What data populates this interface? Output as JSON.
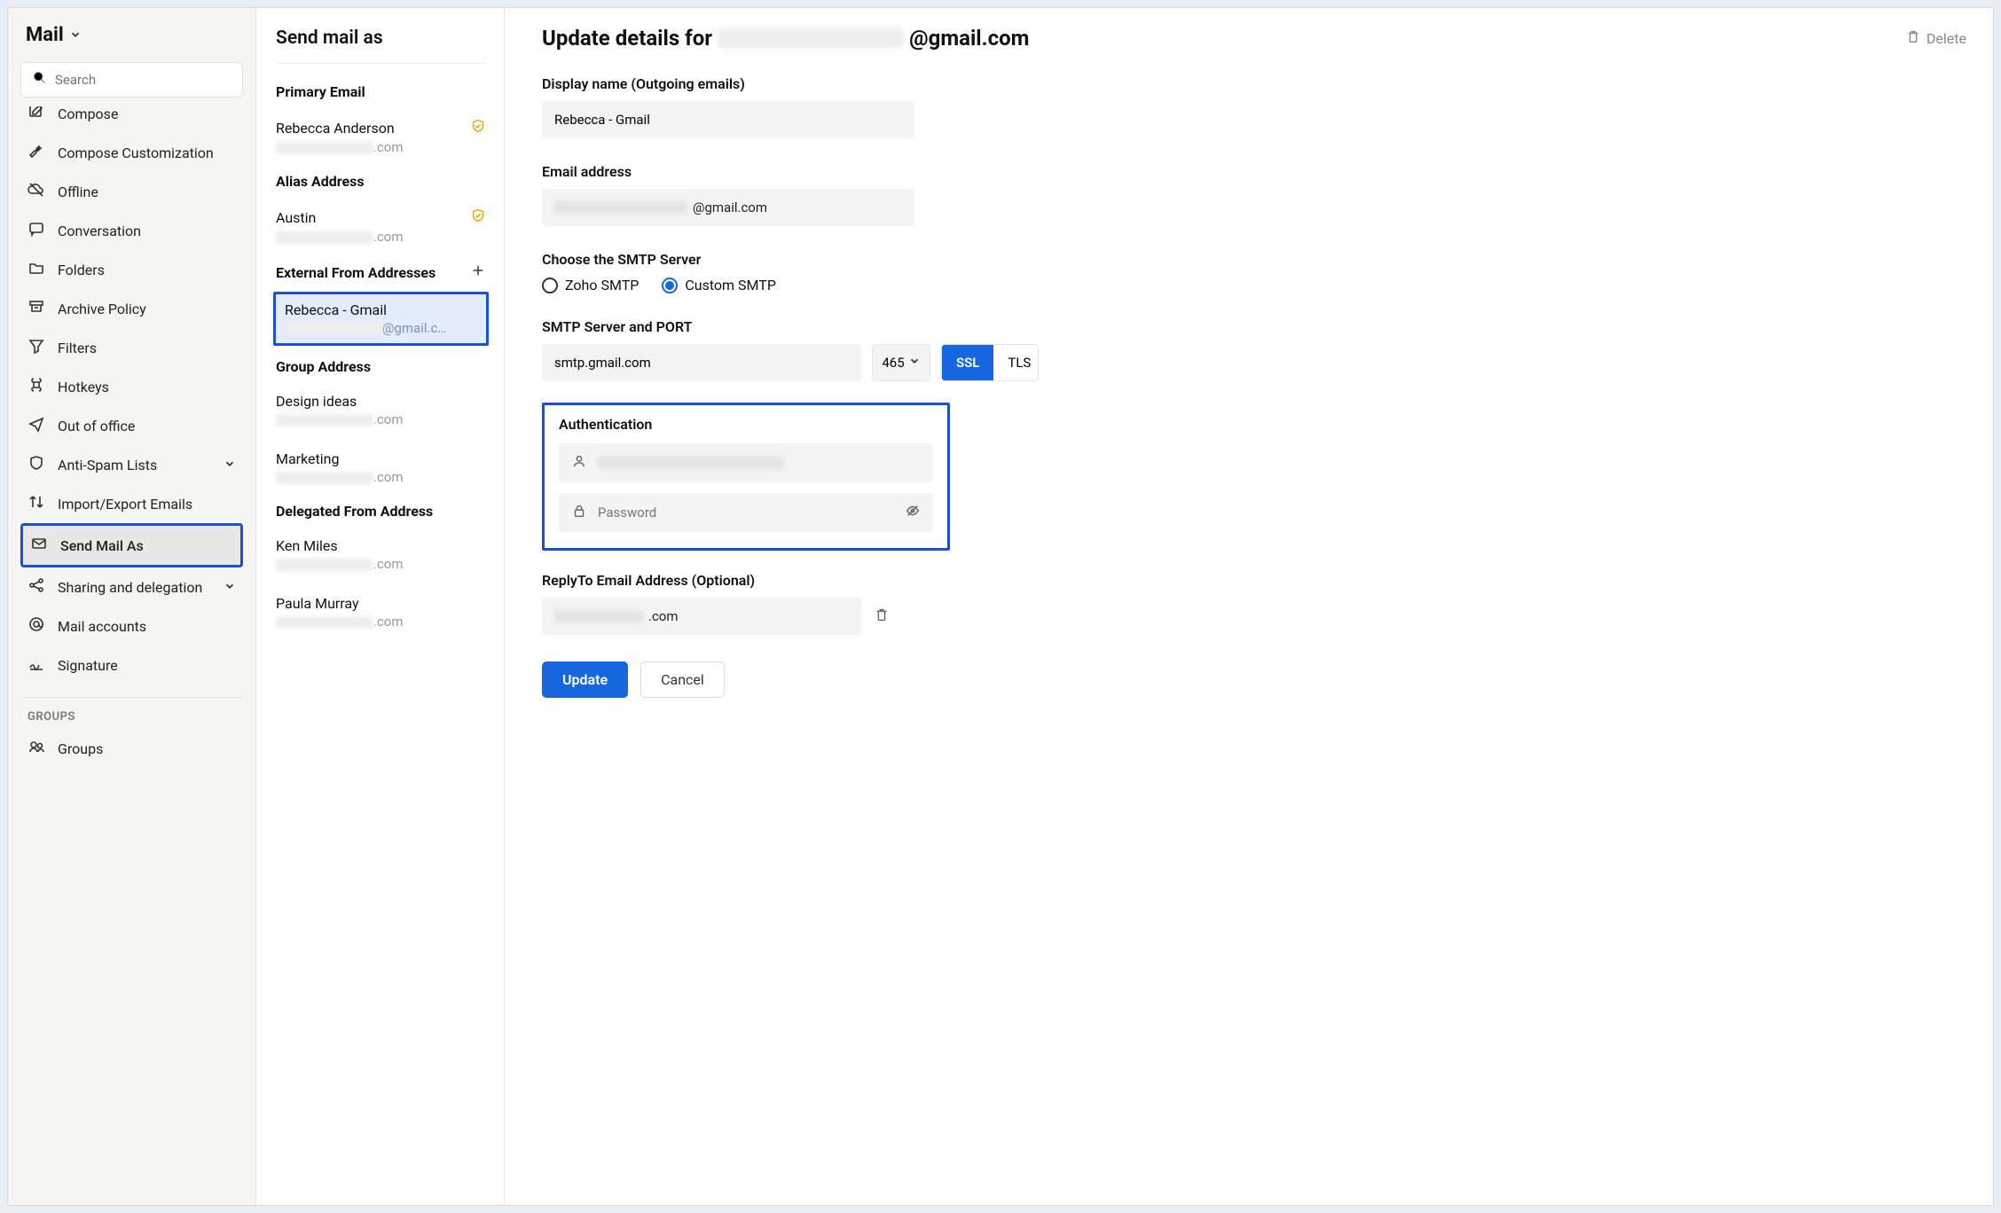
{
  "sidebar": {
    "title": "Mail",
    "search_placeholder": "Search",
    "items": [
      {
        "icon": "compose",
        "label": "Compose"
      },
      {
        "icon": "wrench",
        "label": "Compose Customization"
      },
      {
        "icon": "cloud-off",
        "label": "Offline"
      },
      {
        "icon": "chat",
        "label": "Conversation"
      },
      {
        "icon": "folder",
        "label": "Folders"
      },
      {
        "icon": "archive",
        "label": "Archive Policy"
      },
      {
        "icon": "funnel",
        "label": "Filters"
      },
      {
        "icon": "command",
        "label": "Hotkeys"
      },
      {
        "icon": "plane",
        "label": "Out of office"
      },
      {
        "icon": "shield",
        "label": "Anti-Spam Lists",
        "chevron": true
      },
      {
        "icon": "swap",
        "label": "Import/Export Emails"
      },
      {
        "icon": "send-as",
        "label": "Send Mail As",
        "active": true
      },
      {
        "icon": "share",
        "label": "Sharing and delegation",
        "chevron": true
      },
      {
        "icon": "at",
        "label": "Mail accounts"
      },
      {
        "icon": "signature",
        "label": "Signature"
      }
    ],
    "groups_label": "GROUPS",
    "groups_item": "Groups"
  },
  "midcol": {
    "title": "Send mail as",
    "sections": {
      "primary": {
        "title": "Primary Email",
        "entries": [
          {
            "name": "Rebecca Anderson",
            "suffix": ".com",
            "verified": true
          }
        ]
      },
      "alias": {
        "title": "Alias Address",
        "entries": [
          {
            "name": "Austin",
            "suffix": ".com",
            "verified": true
          }
        ]
      },
      "external": {
        "title": "External From Addresses",
        "add": true,
        "entries": [
          {
            "name": "Rebecca - Gmail",
            "suffix": "@gmail.c…",
            "selected": true
          }
        ]
      },
      "group": {
        "title": "Group Address",
        "entries": [
          {
            "name": "Design ideas",
            "suffix": ".com"
          },
          {
            "name": "Marketing",
            "suffix": ".com"
          }
        ]
      },
      "delegated": {
        "title": "Delegated From Address",
        "entries": [
          {
            "name": "Ken Miles",
            "suffix": ".com"
          },
          {
            "name": "Paula Murray",
            "suffix": ".com"
          }
        ]
      }
    }
  },
  "detail": {
    "title_prefix": "Update details for",
    "title_suffix": "@gmail.com",
    "delete_label": "Delete",
    "display_name_label": "Display name (Outgoing emails)",
    "display_name_value": "Rebecca - Gmail",
    "email_label": "Email address",
    "email_suffix": "@gmail.com",
    "smtp_choose_label": "Choose the SMTP Server",
    "smtp_options": {
      "zoho": "Zoho SMTP",
      "custom": "Custom SMTP"
    },
    "smtp_selected": "custom",
    "smtp_host_label": "SMTP Server and PORT",
    "smtp_host_value": "smtp.gmail.com",
    "smtp_port_value": "465",
    "enc_options": {
      "ssl": "SSL",
      "tls": "TLS"
    },
    "enc_selected": "ssl",
    "auth_label": "Authentication",
    "auth_password_placeholder": "Password",
    "replyto_label": "ReplyTo Email Address (Optional)",
    "replyto_suffix": ".com",
    "update_label": "Update",
    "cancel_label": "Cancel"
  }
}
